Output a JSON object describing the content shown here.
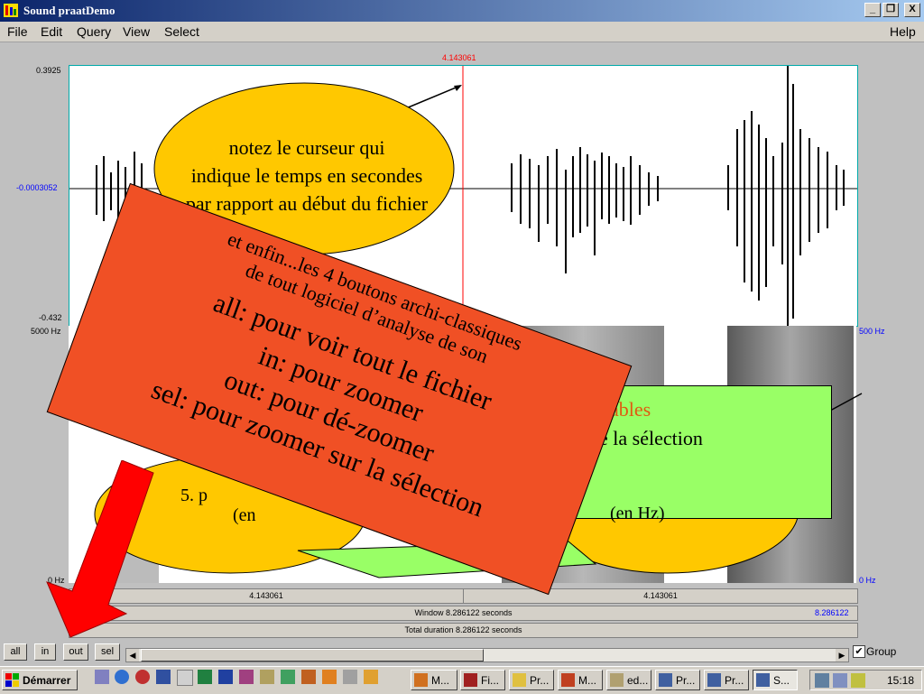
{
  "window": {
    "title": "Sound praatDemo",
    "minimize": "_",
    "restore": "❐",
    "close": "X"
  },
  "menu": {
    "items": [
      "File",
      "Edit",
      "Query",
      "View",
      "Select"
    ],
    "help": "Help"
  },
  "waveform": {
    "top_value": "0.3925",
    "mid_value": "-0.0003052",
    "bottom_value": "-0.432",
    "cursor_time": "4.143061"
  },
  "spectrogram": {
    "top_left": "5000 Hz",
    "bottom_left": "0 Hz",
    "top_right": "500 Hz",
    "bottom_right": "0 Hz"
  },
  "time_bars": {
    "left_segment": "4.143061",
    "right_segment": "4.143061",
    "window": "Window 8.286122 seconds",
    "window_end": "8.286122",
    "total": "Total duration 8.286122 seconds"
  },
  "callouts": {
    "cursor_note": [
      "notez le curseur qui",
      "indique le temps en secondes",
      "par rapport au début du fichier"
    ],
    "green_partial_1": "ables",
    "green_partial_2": "de la sélection",
    "left_partial": "5. p",
    "left_partial_2": "(en",
    "right_partial": "(en Hz)",
    "red_box_intro": [
      "et enfin...les 4 boutons archi-classiques",
      "de tout logiciel d’analyse de son"
    ],
    "red_box_lines": [
      "all: pour voir tout le fichier",
      "in: pour zoomer",
      "out: pour dé-zoomer",
      "sel: pour zoomer sur la sélection"
    ]
  },
  "bottom_toolbar": {
    "buttons": [
      "all",
      "in",
      "out",
      "sel"
    ],
    "group_label": "Group",
    "group_checked": true
  },
  "taskbar": {
    "start": "Démarrer",
    "tasks": [
      "M...",
      "Fi...",
      "Pr...",
      "M...",
      "ed...",
      "Pr...",
      "Pr...",
      "S..."
    ],
    "clock": "15:18"
  },
  "colors": {
    "callout_yellow": "#ffc800",
    "callout_green": "#99ff66",
    "red_box": "#f05025",
    "arrow_red": "#ff0000",
    "accent_orange": "#e05a10"
  }
}
